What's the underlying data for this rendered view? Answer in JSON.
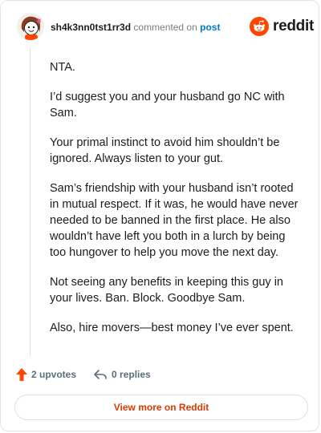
{
  "header": {
    "username": "sh4k3nn0tst1rr3d",
    "action_text": "commented on",
    "post_link": "post",
    "logo_text": "reddit"
  },
  "comment": {
    "paragraphs": [
      "NTA.",
      "I’d suggest you and your husband go NC with Sam.",
      "Your primal instinct to avoid him shouldn’t be ignored. Always listen to your gut.",
      "Sam’s friendship with your husband isn’t rooted in mutual respect. If it was, he would have never needed to be banned in the first place. He also wouldn’t have left you both in a lurch by being too hungover to help you move the next day.",
      "Not seeing any benefits in keeping this guy in your lives. Ban. Block. Goodbye Sam.",
      "Also, hire movers—best money I’ve ever spent."
    ]
  },
  "footer": {
    "upvotes": "2 upvotes",
    "replies": "0 replies",
    "upvote_icon": "upvote-arrow-icon",
    "reply_icon": "reply-arrow-icon"
  },
  "view_more_label": "View more on Reddit",
  "colors": {
    "brand": "#ff4500",
    "link": "#0079d3",
    "view_more": "#d93a00",
    "muted": "#576f76"
  }
}
